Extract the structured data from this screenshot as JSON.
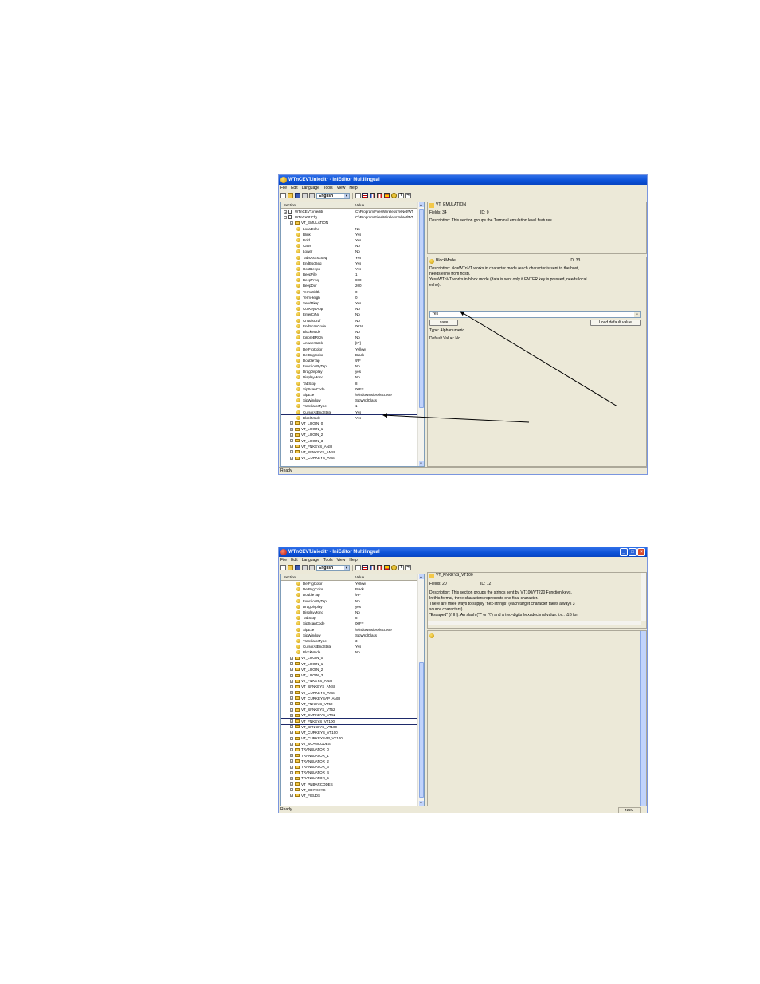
{
  "window1": {
    "title": "WTnCEVT.inieditr - IniEditor Multilingual",
    "menu": [
      "File",
      "Edit",
      "Language",
      "Tools",
      "View",
      "Help"
    ],
    "language": "English",
    "columns": {
      "section": "Section",
      "value": "Value"
    },
    "tree": [
      {
        "kind": "file",
        "indent": 0,
        "name": "WTnCEVT.inieditr",
        "value": "C:\\Program Files\\WirelessTelNet\\WT"
      },
      {
        "kind": "file",
        "indent": 0,
        "name": "WTnCeVt.Cfg",
        "value": "C:\\Program Files\\WirelessTelNet\\WT"
      },
      {
        "kind": "folder",
        "indent": 1,
        "name": "VT_EMULATION",
        "value": ""
      },
      {
        "kind": "key",
        "indent": 2,
        "name": "LocalEcho",
        "value": "No"
      },
      {
        "kind": "key",
        "indent": 2,
        "name": "Blink",
        "value": "Yes"
      },
      {
        "kind": "key",
        "indent": 2,
        "name": "Bold",
        "value": "Yes"
      },
      {
        "kind": "key",
        "indent": 2,
        "name": "Caps",
        "value": "No"
      },
      {
        "kind": "key",
        "indent": 2,
        "name": "Lower",
        "value": "No"
      },
      {
        "kind": "key",
        "indent": 2,
        "name": "TabsAsEscSeq",
        "value": "Yes"
      },
      {
        "kind": "key",
        "indent": 2,
        "name": "EndEscSeq",
        "value": "Yes"
      },
      {
        "kind": "key",
        "indent": 2,
        "name": "HostBeeps",
        "value": "Yes"
      },
      {
        "kind": "key",
        "indent": 2,
        "name": "BeepFile",
        "value": "1"
      },
      {
        "kind": "key",
        "indent": 2,
        "name": "BeepFreq",
        "value": "800"
      },
      {
        "kind": "key",
        "indent": 2,
        "name": "BeepDur",
        "value": "200"
      },
      {
        "kind": "key",
        "indent": 2,
        "name": "TermWidth",
        "value": "0"
      },
      {
        "kind": "key",
        "indent": 2,
        "name": "TermHeigh",
        "value": "0"
      },
      {
        "kind": "key",
        "indent": 2,
        "name": "SendBkap",
        "value": "Yes"
      },
      {
        "kind": "key",
        "indent": 2,
        "name": "CurKeysApp",
        "value": "No"
      },
      {
        "kind": "key",
        "indent": 2,
        "name": "EnterCrNu",
        "value": "No"
      },
      {
        "kind": "key",
        "indent": 2,
        "name": "CrNulsCrLf",
        "value": "No"
      },
      {
        "kind": "key",
        "indent": 2,
        "name": "EndScanCode",
        "value": "0010"
      },
      {
        "kind": "key",
        "indent": 2,
        "name": "BlockMode",
        "value": "No"
      },
      {
        "kind": "key",
        "indent": 2,
        "name": "IgnoreBRCM",
        "value": "No"
      },
      {
        "kind": "key",
        "indent": 2,
        "name": "AnswerBack",
        "value": "[IP]"
      },
      {
        "kind": "key",
        "indent": 2,
        "name": "DefFrgColor",
        "value": "Yellow"
      },
      {
        "kind": "key",
        "indent": 2,
        "name": "DefBkgColor",
        "value": "Black"
      },
      {
        "kind": "key",
        "indent": 2,
        "name": "DoubleTap",
        "value": "\\FF"
      },
      {
        "kind": "key",
        "indent": 2,
        "name": "FunctionByTap",
        "value": "No"
      },
      {
        "kind": "key",
        "indent": 2,
        "name": "DragDisplay",
        "value": "yes"
      },
      {
        "kind": "key",
        "indent": 2,
        "name": "DisplayMono",
        "value": "No"
      },
      {
        "kind": "key",
        "indent": 2,
        "name": "TabStop",
        "value": "8"
      },
      {
        "kind": "key",
        "indent": 2,
        "name": "SipScanCode",
        "value": "00FF"
      },
      {
        "kind": "key",
        "indent": 2,
        "name": "SipExe",
        "value": "\\windows\\sipselect.exe"
      },
      {
        "kind": "key",
        "indent": 2,
        "name": "SipWindow",
        "value": "SipWndClass"
      },
      {
        "kind": "key",
        "indent": 2,
        "name": "TranslatorType",
        "value": "1"
      },
      {
        "kind": "key",
        "indent": 2,
        "name": "CursorAtEndState",
        "value": "Yes"
      },
      {
        "kind": "key",
        "indent": 2,
        "name": "BlockMode",
        "value": "Yes",
        "highlight": true
      },
      {
        "kind": "folder",
        "indent": 1,
        "name": "VT_LOGIN_0",
        "value": ""
      },
      {
        "kind": "folder",
        "indent": 1,
        "name": "VT_LOGIN_1",
        "value": ""
      },
      {
        "kind": "folder",
        "indent": 1,
        "name": "VT_LOGIN_2",
        "value": ""
      },
      {
        "kind": "folder",
        "indent": 1,
        "name": "VT_LOGIN_3",
        "value": ""
      },
      {
        "kind": "folder",
        "indent": 1,
        "name": "VT_FNKEYS_ANSI",
        "value": ""
      },
      {
        "kind": "folder",
        "indent": 1,
        "name": "VT_SFNKEYS_ANSI",
        "value": ""
      },
      {
        "kind": "folder",
        "indent": 1,
        "name": "VT_CURKEYS_ANSI",
        "value": ""
      }
    ],
    "section_panel": {
      "name": "VT_EMULATION",
      "fields_label": "Fields: 34",
      "id_label": "ID: 0",
      "description": "Description: This section groups the Terminal emulation level features"
    },
    "key_panel": {
      "name": "BlockMode",
      "id_label": "ID: 33",
      "description_lines": [
        "Description: No=WTnVT works in character mode (each character is sent to the host,",
        "needs echo from host).",
        "Yes=WTnVT works in block mode (data is sent only if ENTER key is pressed, needs local",
        "echo)."
      ],
      "value": "Yes",
      "save_label": "save",
      "load_default_label": "Load default value",
      "type_label": "Type: Alphanumeric",
      "default_label": "Default Value: No"
    },
    "status": "Ready"
  },
  "window2": {
    "title": "WTnCEVT.inieditr - IniEditor Multilingual",
    "menu": [
      "File",
      "Edit",
      "Language",
      "Tools",
      "View",
      "Help"
    ],
    "language": "English",
    "columns": {
      "section": "Section",
      "value": "Value"
    },
    "tree": [
      {
        "kind": "key",
        "indent": 2,
        "name": "DefFrgColor",
        "value": "Yellow"
      },
      {
        "kind": "key",
        "indent": 2,
        "name": "DefBkgColor",
        "value": "Black"
      },
      {
        "kind": "key",
        "indent": 2,
        "name": "DoubleTap",
        "value": "\\FF"
      },
      {
        "kind": "key",
        "indent": 2,
        "name": "FunctionByTap",
        "value": "No"
      },
      {
        "kind": "key",
        "indent": 2,
        "name": "DragDisplay",
        "value": "yes"
      },
      {
        "kind": "key",
        "indent": 2,
        "name": "DisplayMono",
        "value": "No"
      },
      {
        "kind": "key",
        "indent": 2,
        "name": "TabStop",
        "value": "8"
      },
      {
        "kind": "key",
        "indent": 2,
        "name": "SipScanCode",
        "value": "00FF"
      },
      {
        "kind": "key",
        "indent": 2,
        "name": "SipExe",
        "value": "\\windows\\sipselect.exe"
      },
      {
        "kind": "key",
        "indent": 2,
        "name": "SipWindow",
        "value": "SipWndClass"
      },
      {
        "kind": "key",
        "indent": 2,
        "name": "TranslatorType",
        "value": "3"
      },
      {
        "kind": "key",
        "indent": 2,
        "name": "CursorAtEndState",
        "value": "Yes"
      },
      {
        "kind": "key",
        "indent": 2,
        "name": "BlockMode",
        "value": "No"
      },
      {
        "kind": "folder",
        "indent": 1,
        "name": "VT_LOGIN_0",
        "value": ""
      },
      {
        "kind": "folder",
        "indent": 1,
        "name": "VT_LOGIN_1",
        "value": ""
      },
      {
        "kind": "folder",
        "indent": 1,
        "name": "VT_LOGIN_2",
        "value": ""
      },
      {
        "kind": "folder",
        "indent": 1,
        "name": "VT_LOGIN_3",
        "value": ""
      },
      {
        "kind": "folder",
        "indent": 1,
        "name": "VT_FNKEYS_ANSI",
        "value": ""
      },
      {
        "kind": "folder",
        "indent": 1,
        "name": "VT_SFNKEYS_ANSI",
        "value": ""
      },
      {
        "kind": "folder",
        "indent": 1,
        "name": "VT_CURKEYS_ANSI",
        "value": ""
      },
      {
        "kind": "folder",
        "indent": 1,
        "name": "VT_CURKEYSAP_ANSI",
        "value": ""
      },
      {
        "kind": "folder",
        "indent": 1,
        "name": "VT_FNKEYS_VT52",
        "value": ""
      },
      {
        "kind": "folder",
        "indent": 1,
        "name": "VT_SFNKEYS_VT52",
        "value": ""
      },
      {
        "kind": "folder",
        "indent": 1,
        "name": "VT_CURKEYS_VT52",
        "value": ""
      },
      {
        "kind": "folder",
        "indent": 1,
        "name": "VT_FNKEYS_VT100",
        "value": "",
        "highlight": true
      },
      {
        "kind": "folder",
        "indent": 1,
        "name": "VT_SFNKEYS_VT100",
        "value": ""
      },
      {
        "kind": "folder",
        "indent": 1,
        "name": "VT_CURKEYS_VT100",
        "value": ""
      },
      {
        "kind": "folder",
        "indent": 1,
        "name": "VT_CURKEYSAP_VT100",
        "value": ""
      },
      {
        "kind": "folder",
        "indent": 1,
        "name": "VT_SCANCODES",
        "value": ""
      },
      {
        "kind": "folder",
        "indent": 1,
        "name": "TRANSLATOR_0",
        "value": ""
      },
      {
        "kind": "folder",
        "indent": 1,
        "name": "TRANSLATOR_1",
        "value": ""
      },
      {
        "kind": "folder",
        "indent": 1,
        "name": "TRANSLATOR_2",
        "value": ""
      },
      {
        "kind": "folder",
        "indent": 1,
        "name": "TRANSLATOR_3",
        "value": ""
      },
      {
        "kind": "folder",
        "indent": 1,
        "name": "TRANSLATOR_4",
        "value": ""
      },
      {
        "kind": "folder",
        "indent": 1,
        "name": "TRANSLATOR_5",
        "value": ""
      },
      {
        "kind": "folder",
        "indent": 1,
        "name": "VT_PNBARCODES",
        "value": ""
      },
      {
        "kind": "folder",
        "indent": 1,
        "name": "VT_EDITKEYS",
        "value": ""
      },
      {
        "kind": "folder",
        "indent": 1,
        "name": "VT_FIELDS",
        "value": ""
      }
    ],
    "section_panel": {
      "name": "VT_FNKEYS_VT100",
      "fields_label": "Fields: 20",
      "id_label": "ID: 12",
      "description_lines": [
        "Description: This section groups the strings sent by VT100/VT220 Function keys.",
        "In this format, three characters represents one final character.",
        "There are three ways to supply \"hex-strings\" (each target character takes always 3",
        "source characters) :",
        "\"Escaped\" (/HH): An slash (\"/\" or \"\\\") and a two-digits hexadecimal value. i.e.: \\1B for"
      ]
    },
    "status": "Ready",
    "num_indicator": "NUM"
  }
}
